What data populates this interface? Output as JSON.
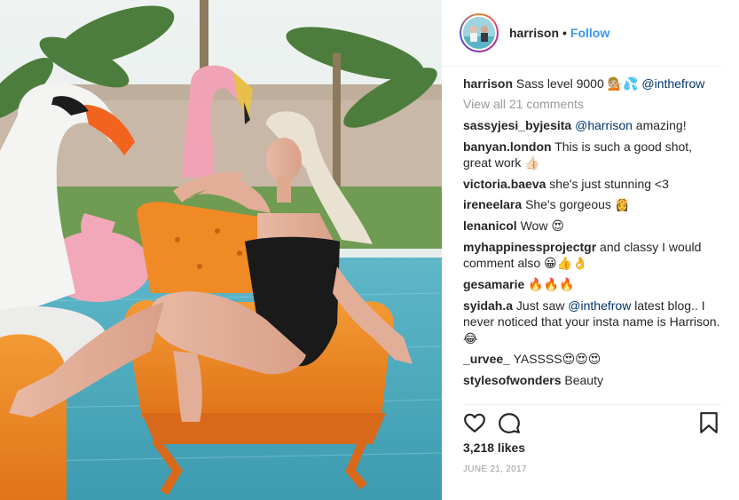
{
  "colors": {
    "link": "#3897f0",
    "mention": "#003569",
    "muted": "#999999",
    "text": "#262626"
  },
  "post": {
    "username": "harrison",
    "separator": "•",
    "follow_label": "Follow",
    "caption": {
      "user": "harrison",
      "text": "Sass level 9000 💁🏼💦 ",
      "mention": "@inthefrow"
    },
    "view_all": "View all 21 comments",
    "comments": [
      {
        "user": "sassyjesi_byjesita",
        "mention": "@harrison",
        "text": " amazing!"
      },
      {
        "user": "banyan.london",
        "text": "This is such a good shot, great work 👍🏻"
      },
      {
        "user": "victoria.baeva",
        "text": "she's just stunning <3"
      },
      {
        "user": "ireneelara",
        "text": "She's gorgeous 👸"
      },
      {
        "user": "lenanicol",
        "text": "Wow 😍"
      },
      {
        "user": "myhappinessprojectgr",
        "text": "and classy I would comment also 😀👍👌"
      },
      {
        "user": "gesamarie",
        "text": "🔥🔥🔥"
      },
      {
        "user": "syidah.a",
        "text_before": "Just saw ",
        "mention": "@inthefrow",
        "text_after": " latest blog.. I never noticed that your insta name is Harrison. 😂"
      },
      {
        "user": "_urvee_",
        "text": "YASSSS😍😍😍"
      },
      {
        "user": "stylesofwonders",
        "text": "Beauty"
      }
    ],
    "likes": "3,218 likes",
    "date": "JUNE 21, 2017",
    "icons": {
      "like": "heart-icon",
      "comment": "speech-bubble-icon",
      "save": "bookmark-icon"
    }
  }
}
